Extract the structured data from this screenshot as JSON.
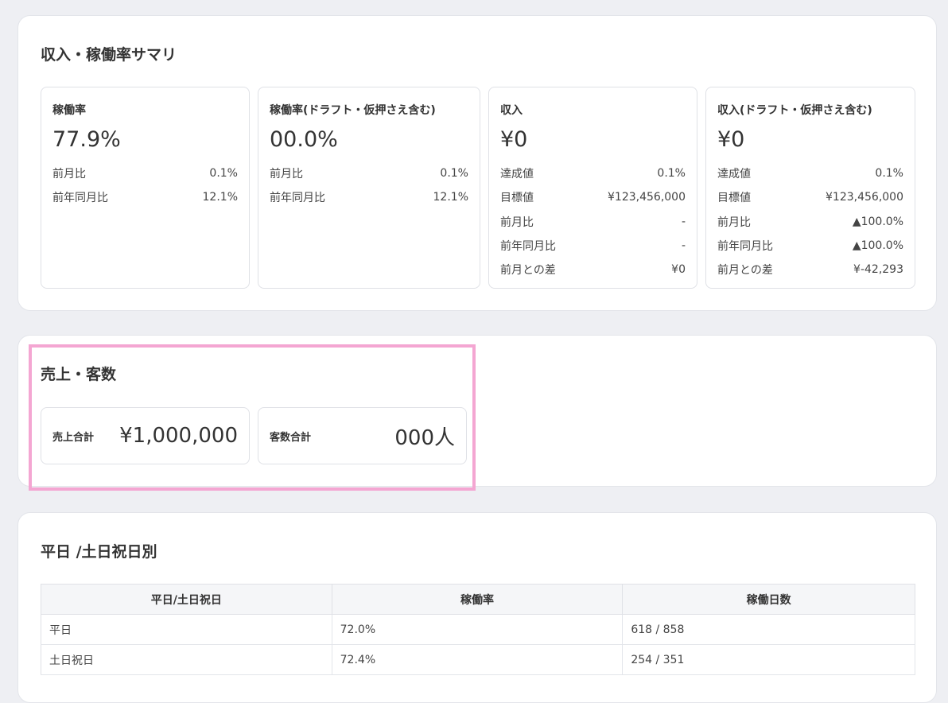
{
  "summary": {
    "title": "収入・稼働率サマリ",
    "cards": [
      {
        "title": "稼働率",
        "value": "77.9%",
        "rows": [
          {
            "label": "前月比",
            "value": "0.1%"
          },
          {
            "label": "前年同月比",
            "value": "12.1%"
          }
        ]
      },
      {
        "title": "稼働率(ドラフト・仮押さえ含む)",
        "value": "00.0%",
        "rows": [
          {
            "label": "前月比",
            "value": "0.1%"
          },
          {
            "label": "前年同月比",
            "value": "12.1%"
          }
        ]
      },
      {
        "title": "収入",
        "value": "¥0",
        "rows": [
          {
            "label": "達成値",
            "value": "0.1%"
          },
          {
            "label": "目標値",
            "value": "¥123,456,000"
          },
          {
            "label": "前月比",
            "value": "-"
          },
          {
            "label": "前年同月比",
            "value": "-"
          },
          {
            "label": "前月との差",
            "value": "¥0"
          }
        ]
      },
      {
        "title": "収入(ドラフト・仮押さえ含む)",
        "value": "¥0",
        "rows": [
          {
            "label": "達成値",
            "value": "0.1%"
          },
          {
            "label": "目標値",
            "value": "¥123,456,000"
          },
          {
            "label": "前月比",
            "value": "▲100.0%"
          },
          {
            "label": "前年同月比",
            "value": "▲100.0%"
          },
          {
            "label": "前月との差",
            "value": "¥-42,293"
          }
        ]
      }
    ]
  },
  "sales": {
    "title": "売上・客数",
    "total_sales_label": "売上合計",
    "total_sales_value": "¥1,000,000",
    "total_customers_label": "客数合計",
    "total_customers_value": "000人"
  },
  "weekday": {
    "title": "平日 /土日祝日別",
    "headers": [
      "平日/土日祝日",
      "稼働率",
      "稼働日数"
    ],
    "rows": [
      [
        "平日",
        "72.0%",
        "618 / 858"
      ],
      [
        "土日祝日",
        "72.4%",
        "254 / 351"
      ]
    ]
  },
  "colors": {
    "highlight": "#f4a6d2",
    "background": "#eeeff3"
  }
}
